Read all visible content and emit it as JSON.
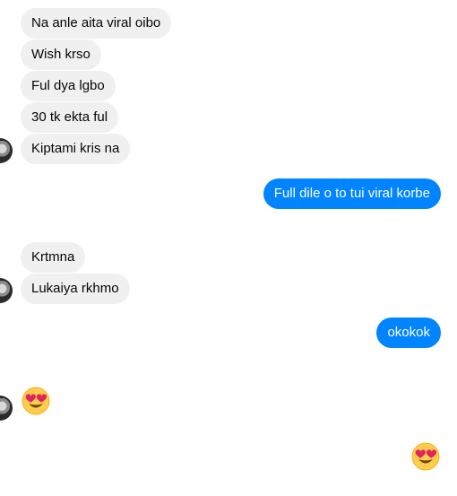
{
  "chat": {
    "incoming_group_1": [
      "Na anle aita viral oibo",
      "Wish krso",
      "Ful dya lgbo",
      "30 tk ekta ful",
      "Kiptami kris na"
    ],
    "outgoing_1": "Full dile o to tui viral korbe",
    "incoming_group_2": [
      "Krtmna",
      "Lukaiya rkhmo"
    ],
    "outgoing_2": "okokok",
    "incoming_emoji": "heart-eyes-emoji",
    "outgoing_emoji": "heart-eyes-emoji"
  },
  "colors": {
    "incoming_bubble": "#f0f0f0",
    "outgoing_bubble": "#0084ff",
    "incoming_text": "#050505",
    "outgoing_text": "#ffffff"
  }
}
